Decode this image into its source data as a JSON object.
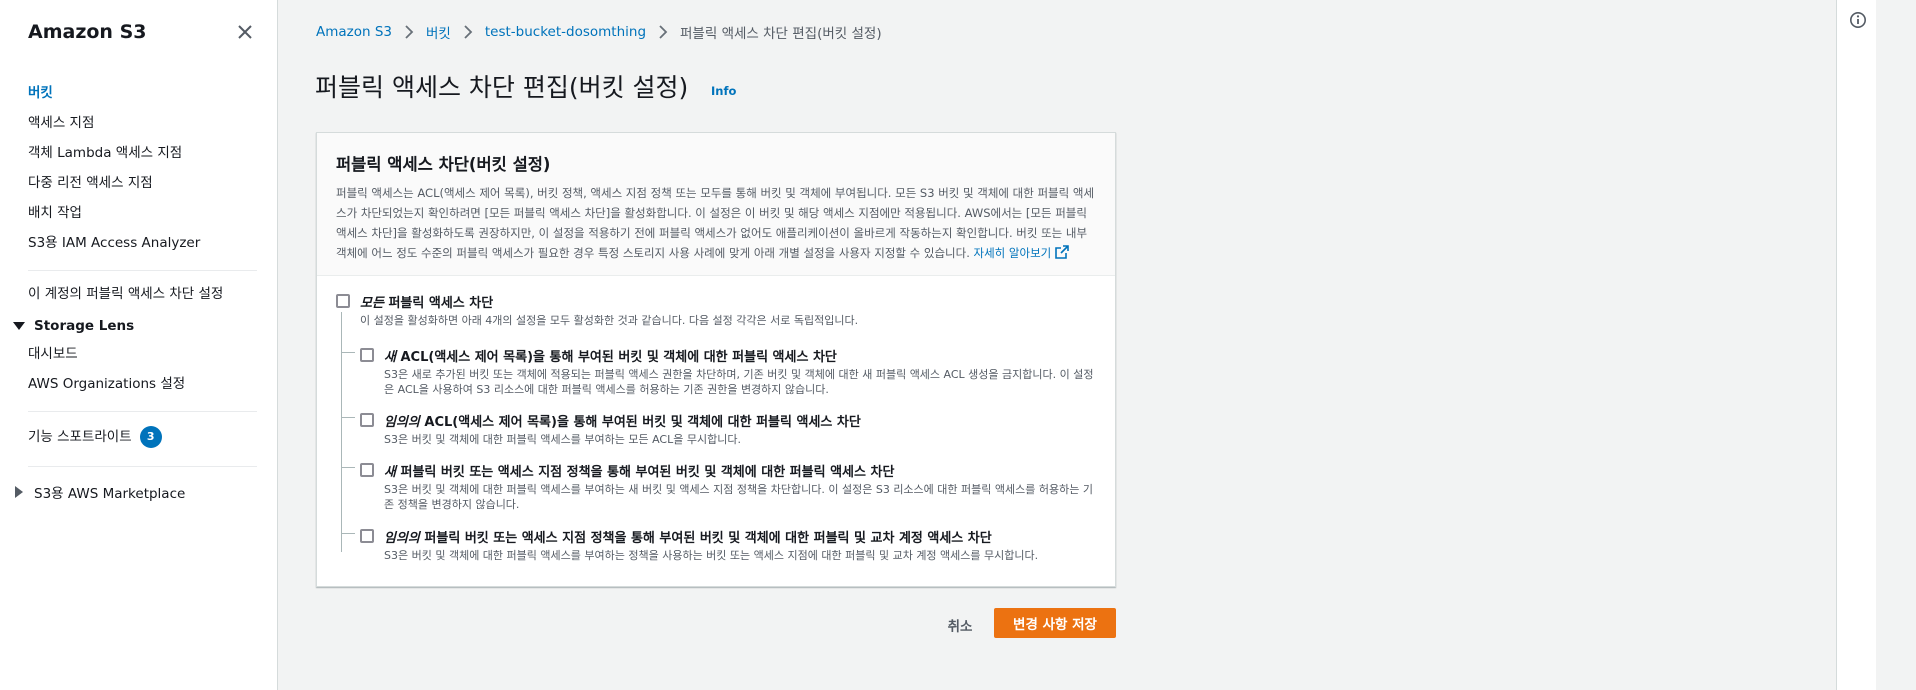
{
  "sidebar": {
    "title": "Amazon S3",
    "items": [
      {
        "label": "버킷"
      },
      {
        "label": "액세스 지점"
      },
      {
        "label": "객체 Lambda 액세스 지점"
      },
      {
        "label": "다중 리전 액세스 지점"
      },
      {
        "label": "배치 작업"
      },
      {
        "label": "S3용 IAM Access Analyzer"
      }
    ],
    "account_block": "이 계정의 퍼블릭 액세스 차단 설정",
    "storage_lens": {
      "label": "Storage Lens",
      "items": [
        {
          "label": "대시보드"
        },
        {
          "label": "AWS Organizations 설정"
        }
      ]
    },
    "feature_spotlight": {
      "label": "기능 스포트라이트",
      "badge": "3"
    },
    "marketplace": "S3용 AWS Marketplace"
  },
  "breadcrumb": {
    "items": [
      "Amazon S3",
      "버킷",
      "test-bucket-dosomthing"
    ],
    "current": "퍼블릭 액세스 차단 편집(버킷 설정)"
  },
  "page": {
    "title": "퍼블릭 액세스 차단 편집(버킷 설정)",
    "info": "Info"
  },
  "panel": {
    "title": "퍼블릭 액세스 차단(버킷 설정)",
    "description": "퍼블릭 액세스는 ACL(액세스 제어 목록), 버킷 정책, 액세스 지점 정책 또는 모두를 통해 버킷 및 객체에 부여됩니다. 모든 S3 버킷 및 객체에 대한 퍼블릭 액세스가 차단되었는지 확인하려면 [모든 퍼블릭 액세스 차단]을 활성화합니다. 이 설정은 이 버킷 및 해당 액세스 지점에만 적용됩니다. AWS에서는 [모든 퍼블릭 액세스 차단]을 활성화하도록 권장하지만, 이 설정을 적용하기 전에 퍼블릭 액세스가 없어도 애플리케이션이 올바르게 작동하는지 확인합니다. 버킷 또는 내부 객체에 어느 정도 수준의 퍼블릭 액세스가 필요한 경우 특정 스토리지 사용 사례에 맞게 아래 개별 설정을 사용자 지정할 수 있습니다.",
    "learn_more": "자세히 알아보기",
    "options": {
      "all": {
        "emph": "모든",
        "label": " 퍼블릭 액세스 차단",
        "desc": "이 설정을 활성화하면 아래 4개의 설정을 모두 활성화한 것과 같습니다. 다음 설정 각각은 서로 독립적입니다.",
        "checked": false
      },
      "new_acl": {
        "emph": "새",
        "label": " ACL(액세스 제어 목록)을 통해 부여된 버킷 및 객체에 대한 퍼블릭 액세스 차단",
        "desc": "S3은 새로 추가된 버킷 또는 객체에 적용되는 퍼블릭 액세스 권한을 차단하며, 기존 버킷 및 객체에 대한 새 퍼블릭 액세스 ACL 생성을 금지합니다. 이 설정은 ACL을 사용하여 S3 리소스에 대한 퍼블릭 액세스를 허용하는 기존 권한을 변경하지 않습니다.",
        "checked": false
      },
      "any_acl": {
        "emph": "임의의",
        "label": " ACL(액세스 제어 목록)을 통해 부여된 버킷 및 객체에 대한 퍼블릭 액세스 차단",
        "desc": "S3은 버킷 및 객체에 대한 퍼블릭 액세스를 부여하는 모든 ACL을 무시합니다.",
        "checked": false
      },
      "new_policy": {
        "emph": "새",
        "label": " 퍼블릭 버킷 또는 액세스 지점 정책을 통해 부여된 버킷 및 객체에 대한 퍼블릭 액세스 차단",
        "desc": "S3은 버킷 및 객체에 대한 퍼블릭 액세스를 부여하는 새 버킷 및 액세스 지점 정책을 차단합니다. 이 설정은 S3 리소스에 대한 퍼블릭 액세스를 허용하는 기존 정책을 변경하지 않습니다.",
        "checked": false
      },
      "any_policy": {
        "emph": "임의의",
        "label": " 퍼블릭 버킷 또는 액세스 지점 정책을 통해 부여된 버킷 및 객체에 대한 퍼블릭 및 교차 계정 액세스 차단",
        "desc": "S3은 버킷 및 객체에 대한 퍼블릭 액세스를 부여하는 정책을 사용하는 버킷 또는 액세스 지점에 대한 퍼블릭 및 교차 계정 액세스를 무시합니다.",
        "checked": false
      }
    }
  },
  "actions": {
    "cancel": "취소",
    "save": "변경 사항 저장"
  },
  "colors": {
    "accent_link": "#0073bb",
    "primary_button": "#ec7211",
    "text": "#16191f",
    "secondary_text": "#545b64"
  },
  "icons": {
    "close": "close-icon",
    "info": "info-icon",
    "breadcrumb_separator": "chevron-right-icon",
    "external_link": "external-link-icon",
    "section_toggle": "caret-icon"
  }
}
